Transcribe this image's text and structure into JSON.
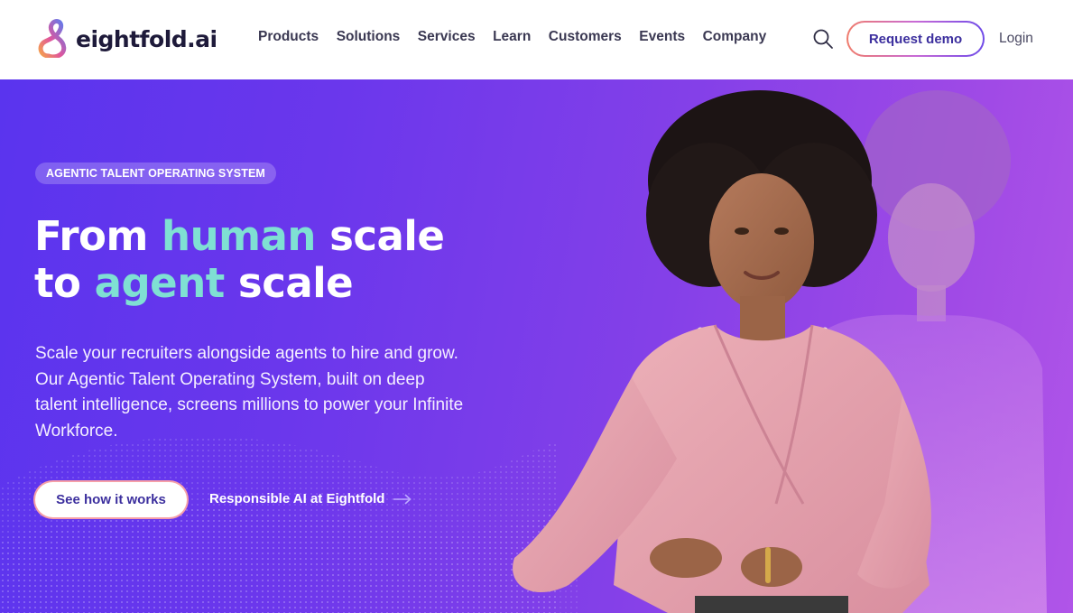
{
  "header": {
    "logo_text": "eightfold.ai",
    "logo_icon": "infinity-loop-logo",
    "nav": [
      {
        "label": "Products"
      },
      {
        "label": "Solutions"
      },
      {
        "label": "Services"
      },
      {
        "label": "Learn"
      },
      {
        "label": "Customers"
      },
      {
        "label": "Events"
      },
      {
        "label": "Company"
      }
    ],
    "search_icon": "search-icon",
    "request_demo_label": "Request demo",
    "login_label": "Login"
  },
  "hero": {
    "badge": "AGENTIC TALENT OPERATING SYSTEM",
    "headline": {
      "line1_prefix": "From ",
      "line1_highlight": "human",
      "line1_suffix": " scale",
      "line2_prefix": "to ",
      "line2_highlight": "agent",
      "line2_suffix": " scale"
    },
    "description": "Scale your recruiters alongside agents to hire and grow. Our Agentic Talent Operating System, built on deep talent intelligence, screens millions to power your Infinite Workforce.",
    "primary_cta": "See how it works",
    "secondary_cta": "Responsible AI at Eightfold",
    "secondary_cta_icon": "arrow-right-icon"
  },
  "colors": {
    "brand_dark": "#1e1a3a",
    "accent_purple": "#3c2f9e",
    "headline_highlight": "#7fe0d3",
    "hero_gradient_start": "#5a34ee",
    "hero_gradient_end": "#b055e8"
  }
}
